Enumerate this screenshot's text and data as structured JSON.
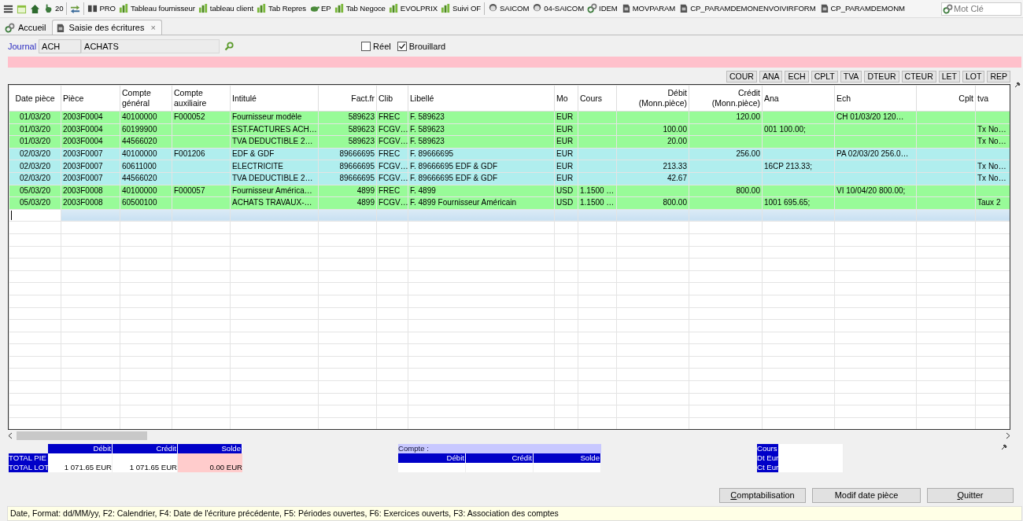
{
  "toolbar": {
    "items": [
      {
        "kind": "menu"
      },
      {
        "kind": "calendar"
      },
      {
        "kind": "home"
      },
      {
        "kind": "hand",
        "label": "20"
      },
      {
        "kind": "separator"
      },
      {
        "kind": "swap"
      },
      {
        "kind": "separator"
      },
      {
        "kind": "book",
        "label": "PRO"
      },
      {
        "kind": "chart",
        "label": "Tableau fournisseur"
      },
      {
        "kind": "chart",
        "label": "tableau client"
      },
      {
        "kind": "chart",
        "label": "Tab Repres"
      },
      {
        "kind": "turtle",
        "label": "EP"
      },
      {
        "kind": "chart",
        "label": "Tab Negoce"
      },
      {
        "kind": "chart",
        "label": "EVOLPRIX"
      },
      {
        "kind": "chart",
        "label": "Suivi OF"
      },
      {
        "kind": "separator"
      },
      {
        "kind": "face",
        "label": "SAICOM"
      },
      {
        "kind": "face",
        "label": "04-SAICOM"
      },
      {
        "kind": "link",
        "label": "IDEM"
      },
      {
        "kind": "doc",
        "label": "MOVPARAM"
      },
      {
        "kind": "doc",
        "label": "CP_PARAMDEMONENVOIVIRFORM"
      },
      {
        "kind": "doc",
        "label": "CP_PARAMDEMONM"
      }
    ],
    "search": {
      "placeholder": "Mot Clé"
    }
  },
  "tabs": [
    {
      "label": "Accueil",
      "selected": false,
      "kind": "link"
    },
    {
      "label": "Saisie des écritures",
      "selected": true,
      "kind": "doc",
      "close": "×"
    }
  ],
  "journal": {
    "label": "Journal",
    "code": "ACH",
    "name": "ACHATS"
  },
  "options": [
    {
      "label": "Réel",
      "checked": false
    },
    {
      "label": "Brouillard",
      "checked": true
    }
  ],
  "column_buttons": [
    "COUR",
    "ANA",
    "ECH",
    "CPLT",
    "TVA",
    "DTEUR",
    "CTEUR",
    "LET",
    "LOT",
    "REP"
  ],
  "table": {
    "columns": [
      "Date pièce",
      "Pièce",
      "Compte général",
      "Compte auxiliaire",
      "Intitulé",
      "Fact.fr",
      "Clib",
      "Libellé",
      "Mo",
      "Cours",
      "Débit (Monn.pièce)",
      "Crédit (Monn.pièce)",
      "Ana",
      "Ech",
      "Cplt",
      "tva"
    ],
    "rows": [
      {
        "color": "#98fb98",
        "cells": [
          "01/03/20",
          "2003F0004",
          "40100000",
          "F000052",
          "Fournisseur modèle",
          "589623",
          "FREC",
          "F. 589623",
          "EUR",
          null,
          null,
          "120.00",
          null,
          "CH 01/03/20 120…",
          null,
          null
        ]
      },
      {
        "color": "#98fb98",
        "cells": [
          "01/03/20",
          "2003F0004",
          "60199900",
          null,
          "EST.FACTURES ACH…",
          "589623",
          "FCGV…",
          "F. 589623",
          "EUR",
          null,
          "100.00",
          null,
          "001 100.00;",
          null,
          null,
          "Tx No…"
        ]
      },
      {
        "color": "#98fb98",
        "cells": [
          "01/03/20",
          "2003F0004",
          "44566020",
          null,
          "TVA DEDUCTIBLE 2…",
          "589623",
          "FCGV…",
          "F. 589623",
          "EUR",
          null,
          "20.00",
          null,
          null,
          null,
          null,
          "Tx No…"
        ]
      },
      {
        "color": "#b0eeee",
        "cells": [
          "02/03/20",
          "2003F0007",
          "40100000",
          "F001206",
          "EDF & GDF",
          "89666695",
          "FREC",
          "F. 89666695",
          "EUR",
          null,
          null,
          "256.00",
          null,
          "PA 02/03/20 256.0…",
          null,
          null
        ]
      },
      {
        "color": "#b0eeee",
        "cells": [
          "02/03/20",
          "2003F0007",
          "60611000",
          null,
          "ELECTRICITE",
          "89666695",
          "FCGV…",
          "F. 89666695 EDF & GDF",
          "EUR",
          null,
          "213.33",
          null,
          "16CP 213.33;",
          null,
          null,
          "Tx No…"
        ]
      },
      {
        "color": "#b0eeee",
        "cells": [
          "02/03/20",
          "2003F0007",
          "44566020",
          null,
          "TVA DEDUCTIBLE 2…",
          "89666695",
          "FCGV…",
          "F. 89666695 EDF & GDF",
          "EUR",
          null,
          "42.67",
          null,
          null,
          null,
          null,
          "Tx No…"
        ]
      },
      {
        "color": "#98fb98",
        "cells": [
          "05/03/20",
          "2003F0008",
          "40100000",
          "F000057",
          "Fournisseur Américа…",
          "4899",
          "FREC",
          "F. 4899",
          "USD",
          "1.1500 …",
          null,
          "800.00",
          null,
          "VI 10/04/20 800.00;",
          null,
          null
        ]
      },
      {
        "color": "#98fb98",
        "cells": [
          "05/03/20",
          "2003F0008",
          "60500100",
          null,
          "ACHATS TRAVAUX-…",
          "4899",
          "FCGV…",
          "F. 4899 Fournisseur Américain",
          "USD",
          "1.1500 …",
          "800.00",
          null,
          "1001 695.65;",
          null,
          null,
          "Taux 2"
        ]
      }
    ]
  },
  "totals": {
    "columns": [
      "Débit",
      "Crédit",
      "Solde"
    ],
    "rows": [
      {
        "label": "TOTAL PIE"
      },
      {
        "label": "TOTAL LOT",
        "cells": [
          "1 071.65 EUR",
          "1 071.65 EUR",
          "0.00 EUR"
        ]
      }
    ]
  },
  "account_panel": {
    "title": "Compte :",
    "columns": [
      "Débit",
      "Crédit",
      "Solde"
    ]
  },
  "rate_panel": {
    "labels": [
      "Cours",
      "Dt Eur",
      "Ct Eur"
    ]
  },
  "buttons": [
    {
      "label": "Comptabilisation",
      "underline_first": true
    },
    {
      "label": "Modif date pièce",
      "underline_first": false
    },
    {
      "label": "Quitter",
      "underline_first": true
    }
  ],
  "status_bar": "Date, Format: dd/MM/yy, F2: Calendrier, F4: Date de l'écriture précédente, F5: Périodes ouvertes, F6: Exercices ouverts, F3: Association des comptes"
}
